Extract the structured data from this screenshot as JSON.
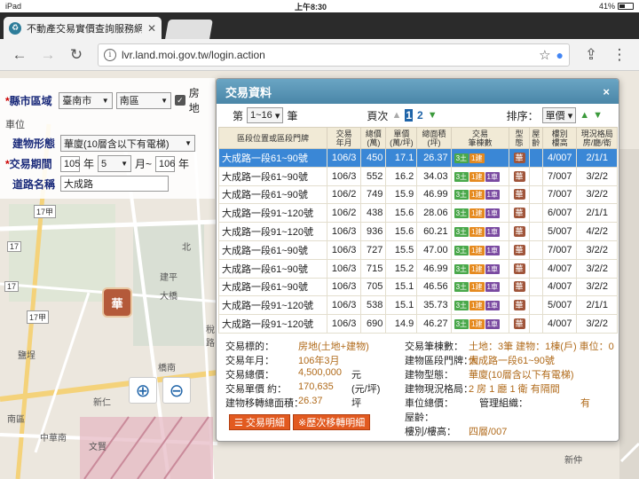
{
  "statusbar": {
    "carrier": "iPad",
    "time": "上午8:30",
    "battery": "41%"
  },
  "browser": {
    "tab_title": "不動產交易實價查詢服務網",
    "tab_favicon": "♻",
    "url": "lvr.land.moi.gov.tw/login.action"
  },
  "map": {
    "labels": [
      "17甲",
      "17",
      "17甲",
      "17",
      "北",
      "建平",
      "大橋",
      "稅",
      "路",
      "橋南",
      "南區",
      "鹽埕",
      "新仁",
      "中華南",
      "文賢",
      "新仲"
    ],
    "marker": "華"
  },
  "searchform": {
    "city_label": "縣市區域",
    "city_value": "臺南市",
    "district_value": "南區",
    "checkbox_label": "房地",
    "unit_label": "車位",
    "building_type_label": "建物形態",
    "building_type_value": "華廈(10層含以下有電梯)",
    "period_label": "交易期間",
    "year_from": "105",
    "year_unit": "年",
    "month_from": "5",
    "month_sep": "月~",
    "year_to": "106",
    "year_unit2": "年",
    "road_label": "道路名稱",
    "road_value": "大成路"
  },
  "modal": {
    "title": "交易資料",
    "close": "×",
    "pager": {
      "prefix": "第",
      "range": "1~16",
      "suffix": "筆",
      "pages_label": "頁次",
      "page1": "1",
      "page2": "2",
      "sort_label": "排序：",
      "sort_value": "單價"
    },
    "headers": [
      "區段位置或區段門牌",
      "交易\n年月",
      "總價\n(萬)",
      "單價\n(萬/坪)",
      "總面積\n(坪)",
      "交易\n筆棟數",
      "型\n態",
      "屋\n齡",
      "樓別\n樓高",
      "現況格局\n房/廳/衛"
    ],
    "rows": [
      {
        "addr": "大成路一段61~90號",
        "ym": "106/3",
        "total": "450",
        "unit": "17.1",
        "area": "26.37",
        "tx": [
          "3土",
          "1建"
        ],
        "type": "華",
        "age": "",
        "floor": "4/007",
        "layout": "2/1/1"
      },
      {
        "addr": "大成路一段61~90號",
        "ym": "106/3",
        "total": "552",
        "unit": "16.2",
        "area": "34.03",
        "tx": [
          "3土",
          "1建",
          "1車"
        ],
        "type": "華",
        "age": "",
        "floor": "7/007",
        "layout": "3/2/2"
      },
      {
        "addr": "大成路一段61~90號",
        "ym": "106/2",
        "total": "749",
        "unit": "15.9",
        "area": "46.99",
        "tx": [
          "3土",
          "1建",
          "1車"
        ],
        "type": "華",
        "age": "",
        "floor": "7/007",
        "layout": "3/2/2"
      },
      {
        "addr": "大成路一段91~120號",
        "ym": "106/2",
        "total": "438",
        "unit": "15.6",
        "area": "28.06",
        "tx": [
          "3土",
          "1建",
          "1車"
        ],
        "type": "華",
        "age": "",
        "floor": "6/007",
        "layout": "2/1/1"
      },
      {
        "addr": "大成路一段91~120號",
        "ym": "106/3",
        "total": "936",
        "unit": "15.6",
        "area": "60.21",
        "tx": [
          "3土",
          "1建",
          "1車"
        ],
        "type": "華",
        "age": "",
        "floor": "5/007",
        "layout": "4/2/2"
      },
      {
        "addr": "大成路一段61~90號",
        "ym": "106/3",
        "total": "727",
        "unit": "15.5",
        "area": "47.00",
        "tx": [
          "3土",
          "1建",
          "1車"
        ],
        "type": "華",
        "age": "",
        "floor": "7/007",
        "layout": "3/2/2"
      },
      {
        "addr": "大成路一段61~90號",
        "ym": "106/3",
        "total": "715",
        "unit": "15.2",
        "area": "46.99",
        "tx": [
          "3土",
          "1建",
          "1車"
        ],
        "type": "華",
        "age": "",
        "floor": "4/007",
        "layout": "3/2/2"
      },
      {
        "addr": "大成路一段61~90號",
        "ym": "106/3",
        "total": "705",
        "unit": "15.1",
        "area": "46.56",
        "tx": [
          "3土",
          "1建",
          "1車"
        ],
        "type": "華",
        "age": "",
        "floor": "4/007",
        "layout": "3/2/2"
      },
      {
        "addr": "大成路一段91~120號",
        "ym": "106/3",
        "total": "538",
        "unit": "15.1",
        "area": "35.73",
        "tx": [
          "3土",
          "1建",
          "1車"
        ],
        "type": "華",
        "age": "",
        "floor": "5/007",
        "layout": "2/1/1"
      },
      {
        "addr": "大成路一段91~120號",
        "ym": "106/3",
        "total": "690",
        "unit": "14.9",
        "area": "46.27",
        "tx": [
          "3土",
          "1建",
          "1車"
        ],
        "type": "華",
        "age": "",
        "floor": "4/007",
        "layout": "3/2/2"
      }
    ],
    "details": {
      "label_target": "交易標的：",
      "value_target": "房地(土地+建物)",
      "label_ym": "交易年月：",
      "value_ym": "106年3月",
      "label_total": "交易總價：",
      "value_total": "4,500,000",
      "unit_total": "元",
      "label_unit": "交易單價 約：",
      "value_unit": "170,635",
      "unit_unit": "(元/坪)",
      "label_area": "建物移轉總面積：",
      "value_area": "26.37",
      "unit_area": "坪",
      "label_count": "交易筆棟數：",
      "value_count": "土地：3筆 建物：1棟(戶) 車位：0個",
      "label_addr": "建物區段門牌：",
      "value_addr": "大成路一段61~90號",
      "label_btype": "建物型態：",
      "value_btype": "華廈(10層含以下有電梯)",
      "label_layout": "建物現況格局：",
      "value_layout": "2 房 1 廳 1 衛 有隔間",
      "label_parking": "車位總價：",
      "label_mgmt": "管理組織：",
      "value_mgmt": "有",
      "label_age": "屋齡：",
      "label_floor": "樓別/樓高：",
      "value_floor": "四層/007"
    },
    "btn_detail": "交易明細",
    "btn_history": "※歷次移轉明細"
  },
  "colors": {
    "selected_row": "#3a87d6",
    "header_bar": "#4a86a8",
    "detail_value": "#b06a1a",
    "action_button": "#e25a20"
  }
}
